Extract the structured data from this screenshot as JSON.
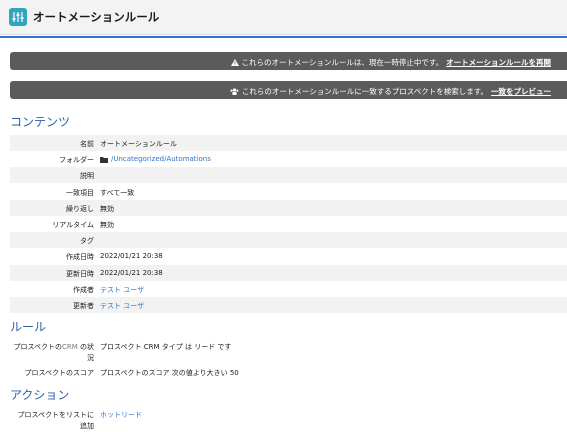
{
  "header": {
    "title": "オートメーションルール",
    "icon": "sliders-icon"
  },
  "banners": {
    "paused": {
      "text": "これらのオートメーションルールは、現在一時停止中です。",
      "link": "オートメーションルールを再開"
    },
    "preview": {
      "text": "これらのオートメーションルールに一致するプロスペクトを検索します。",
      "link": "一致をプレビュー"
    }
  },
  "content": {
    "title": "コンテンツ",
    "fields": [
      {
        "label": "名前",
        "value": "オートメーションルール",
        "link": false
      },
      {
        "label": "フォルダー",
        "value": "/Uncategorized/Automations",
        "link": true,
        "icon": "folder-icon"
      },
      {
        "label": "説明",
        "value": "",
        "link": false
      },
      {
        "label": "一致項目",
        "value": "すべて一致",
        "link": false
      },
      {
        "label": "繰り返し",
        "value": "無効",
        "link": false
      },
      {
        "label": "リアルタイム",
        "value": "無効",
        "link": false
      },
      {
        "label": "タグ",
        "value": "",
        "link": false
      },
      {
        "label": "作成日時",
        "value": "2022/01/21 20:38",
        "link": false
      },
      {
        "label": "更新日時",
        "value": "2022/01/21 20:38",
        "link": false
      },
      {
        "label": "作成者",
        "value": "テスト ユーザ",
        "link": true
      },
      {
        "label": "更新者",
        "value": "テスト ユーザ",
        "link": true
      }
    ]
  },
  "rules": {
    "title": "ルール",
    "items": [
      {
        "label_a": "プロスペクトの",
        "label_crm": "CRM",
        "label_b": " の状",
        "label_line2": "況",
        "value": "プロスペクト CRM タイプ は リード です"
      },
      {
        "label": "プロスペクトのスコア",
        "value": "プロスペクトのスコア 次の値より大きい 50"
      }
    ]
  },
  "actions": {
    "title": "アクション",
    "items": [
      {
        "label_line1": "プロスペクトをリストに",
        "label_line2": "追加",
        "value": "ホットリード"
      }
    ]
  },
  "colors": {
    "accent": "#2f77c9",
    "section_title": "#2a5fa8",
    "banner_bg": "#5b5b5b",
    "app_icon": "#2fa6bf"
  }
}
